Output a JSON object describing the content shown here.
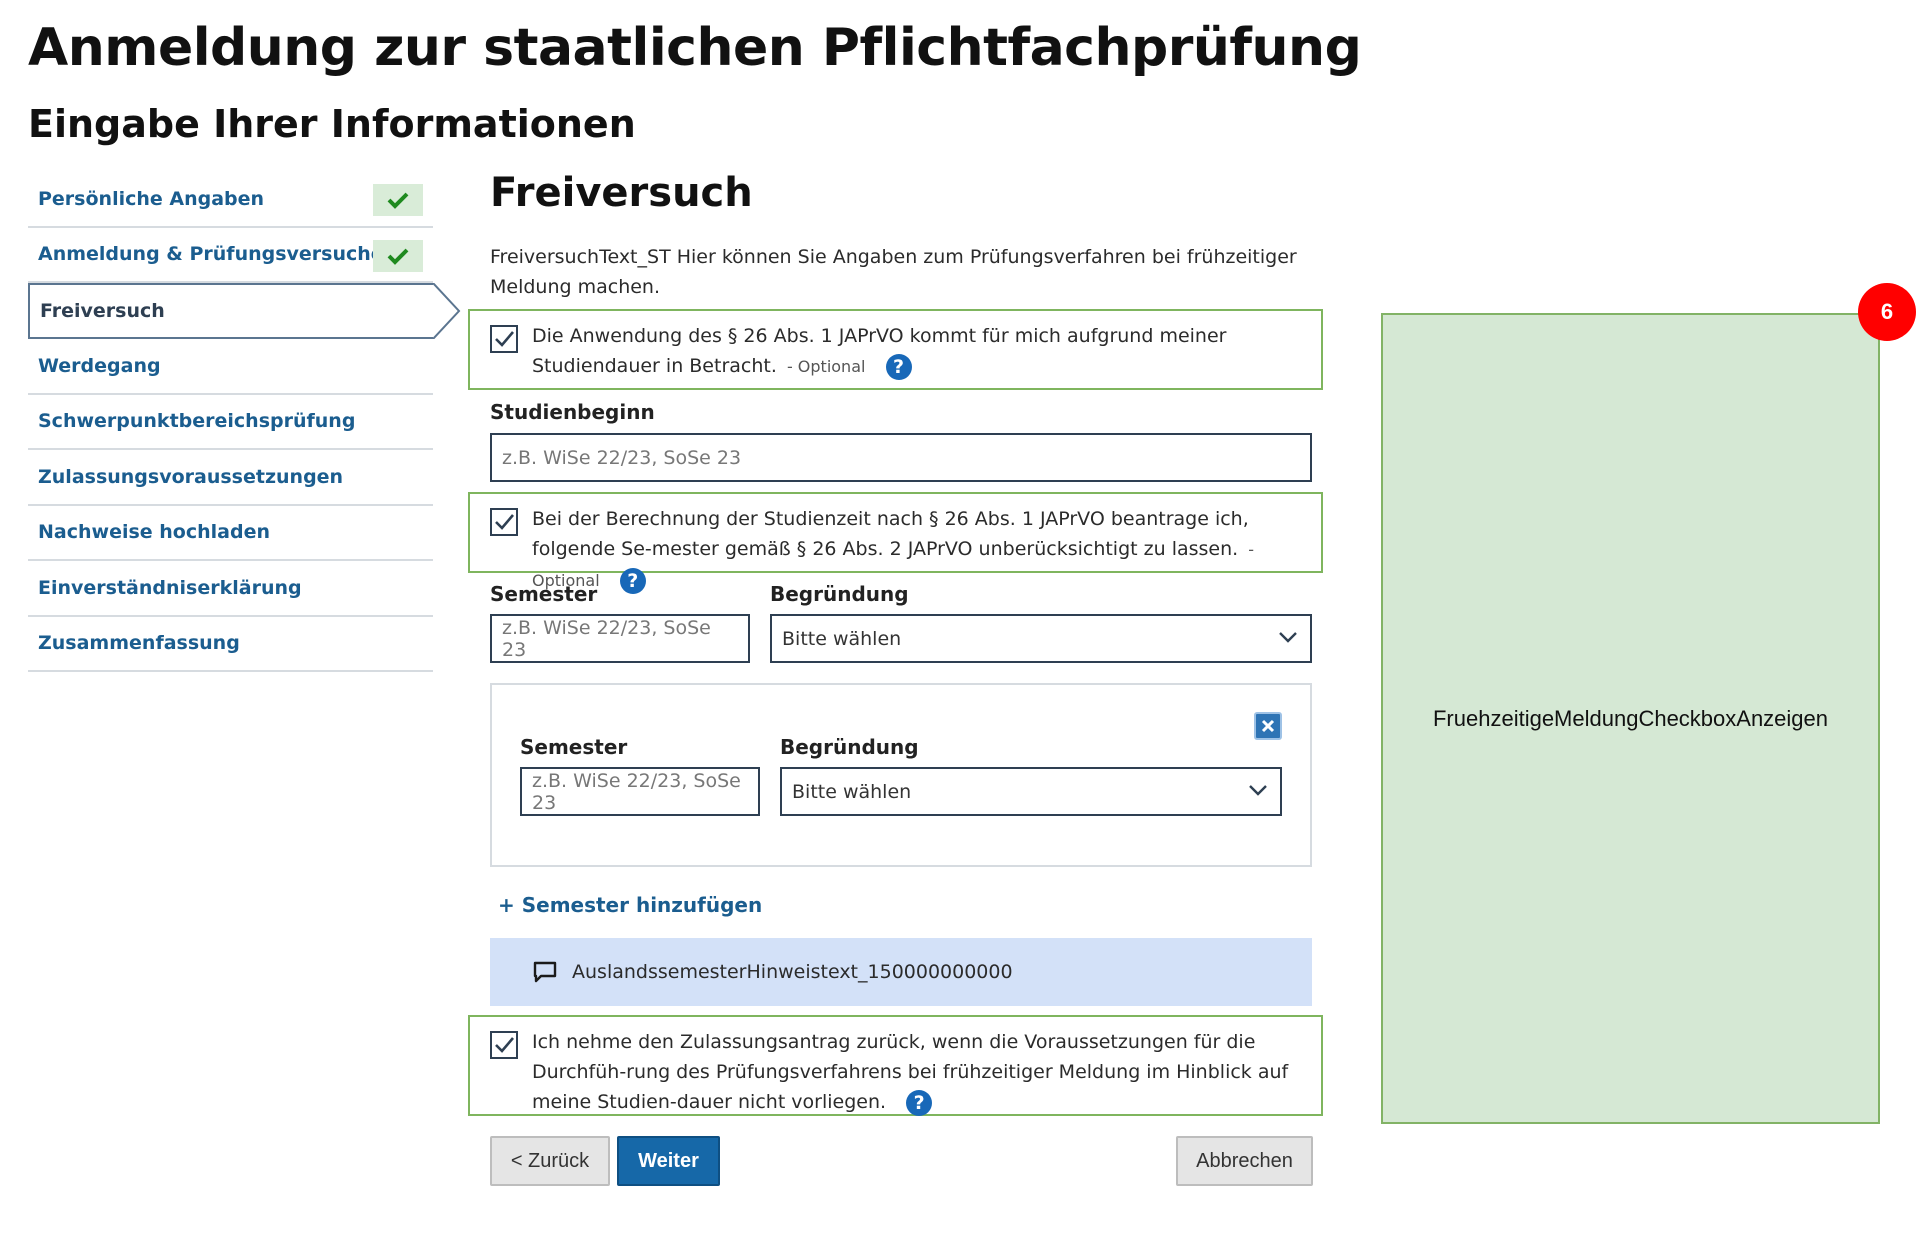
{
  "page": {
    "title": "Anmeldung zur staatlichen Pflichtfachprüfung",
    "subtitle": "Eingabe Ihrer Informationen"
  },
  "sidebar": {
    "items": [
      {
        "label": "Persönliche Angaben",
        "state": "done"
      },
      {
        "label": "Anmeldung & Prüfungsversuche",
        "state": "done"
      },
      {
        "label": "Freiversuch",
        "state": "active"
      },
      {
        "label": "Werdegang",
        "state": "open"
      },
      {
        "label": "Schwerpunktbereichsprüfung",
        "state": "open"
      },
      {
        "label": "Zulassungsvoraussetzungen",
        "state": "open"
      },
      {
        "label": "Nachweise hochladen",
        "state": "open"
      },
      {
        "label": "Einverständniserklärung",
        "state": "open"
      },
      {
        "label": "Zusammenfassung",
        "state": "open"
      }
    ]
  },
  "section": {
    "title": "Freiversuch",
    "intro": "FreiversuchText_ST Hier können Sie Angaben zum Prüfungsverfahren bei frühzeitiger Meldung machen."
  },
  "checkbox1": {
    "checked": true,
    "text": "Die Anwendung des § 26 Abs. 1 JAPrVO kommt für mich aufgrund meiner Studiendauer in Betracht.",
    "optional": "- Optional"
  },
  "studienbeginn": {
    "label": "Studienbeginn",
    "placeholder": "z.B. WiSe 22/23, SoSe 23"
  },
  "checkbox2": {
    "checked": true,
    "text": "Bei der Berechnung der Studienzeit nach § 26 Abs. 1 JAPrVO beantrage ich, folgende Se-mester gemäß § 26 Abs. 2 JAPrVO unberücksichtigt zu lassen.",
    "optional": "- Optional"
  },
  "semester_row1": {
    "semester_label": "Semester",
    "semester_placeholder": "z.B. WiSe 22/23, SoSe 23",
    "reason_label": "Begründung",
    "reason_value": "Bitte wählen"
  },
  "semester_row2": {
    "semester_label": "Semester",
    "semester_placeholder": "z.B. WiSe 22/23, SoSe 23",
    "reason_label": "Begründung",
    "reason_value": "Bitte wählen"
  },
  "add_semester": "+ Semester hinzufügen",
  "info_text": "AuslandssemesterHinweistext_150000000000",
  "checkbox3": {
    "checked": true,
    "text": "Ich nehme den Zulassungsantrag zurück, wenn die Voraussetzungen für die Durchfüh-rung des Prüfungsverfahrens bei frühzeitiger Meldung im Hinblick auf meine Studien-dauer nicht vorliegen."
  },
  "buttons": {
    "back": "< Zurück",
    "next": "Weiter",
    "cancel": "Abbrechen"
  },
  "annotation": {
    "badge": "6",
    "label": "FruehzeitigeMeldungCheckboxAnzeigen"
  },
  "colors": {
    "link": "#1b5d8f",
    "primary": "#1668a8",
    "check_green": "#2e8b2e",
    "highlight_border": "#7fb55e",
    "info_bg": "#d3e1f8",
    "annotation_bg": "#d5e8d4",
    "badge": "#ff0000"
  }
}
